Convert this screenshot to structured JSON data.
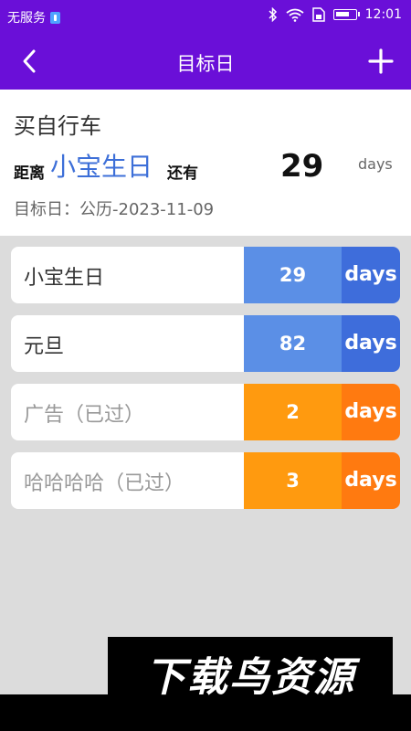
{
  "status_bar": {
    "carrier": "无服务",
    "time": "12:01",
    "icons": [
      "usb-icon",
      "bluetooth-icon",
      "wifi-icon",
      "sim-icon",
      "battery-icon"
    ]
  },
  "app_bar": {
    "title": "目标日",
    "back_icon": "chevron-left-icon",
    "add_icon": "plus-icon"
  },
  "summary": {
    "title": "买自行车",
    "prefix": "距离",
    "event_name": "小宝生日",
    "suffix": "还有",
    "count": "29",
    "unit": "days",
    "target_date": "目标日：公历-2023-11-09"
  },
  "events": [
    {
      "name": "小宝生日",
      "count": "29",
      "unit": "days",
      "status": "upcoming"
    },
    {
      "name": "元旦",
      "count": "82",
      "unit": "days",
      "status": "upcoming"
    },
    {
      "name": "广告（已过）",
      "count": "2",
      "unit": "days",
      "status": "past"
    },
    {
      "name": "哈哈哈哈（已过）",
      "count": "3",
      "unit": "days",
      "status": "past"
    }
  ],
  "colors": {
    "primary": "#6a0fd8",
    "upcoming_count": "#5b8fe6",
    "upcoming_days": "#3e6ddb",
    "past_count": "#ff9a0f",
    "past_days": "#ff7a10",
    "event_name_accent": "#3d6fd8"
  },
  "watermark": "下载鸟资源"
}
